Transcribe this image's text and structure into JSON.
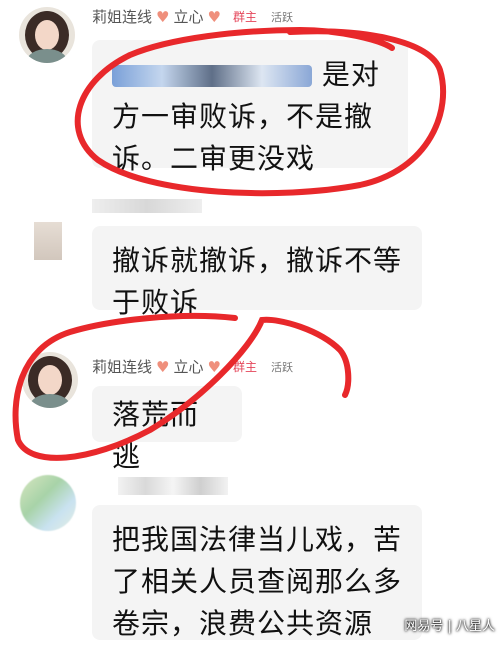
{
  "messages": [
    {
      "sender": "莉姐连线",
      "badge": "立心",
      "role": "群主",
      "status": "活跃",
      "text_line1": "是对",
      "text_line2": "方一审败诉，不是撤",
      "text_line3": "诉。二审更没戏"
    },
    {
      "text_line1": "撤诉就撤诉，撤诉不等",
      "text_line2": "于败诉"
    },
    {
      "sender": "莉姐连线",
      "badge": "立心",
      "role": "群主",
      "status": "活跃",
      "text_line1": "落荒而逃"
    },
    {
      "text_line1": "把我国法律当儿戏，苦",
      "text_line2": "了相关人员查阅那么多",
      "text_line3": "卷宗，浪费公共资源"
    }
  ],
  "watermark": "网易号 | 八星人",
  "colors": {
    "annotation": "#e8282b",
    "owner_badge": "#e4465a",
    "bubble": "#f4f4f4"
  }
}
